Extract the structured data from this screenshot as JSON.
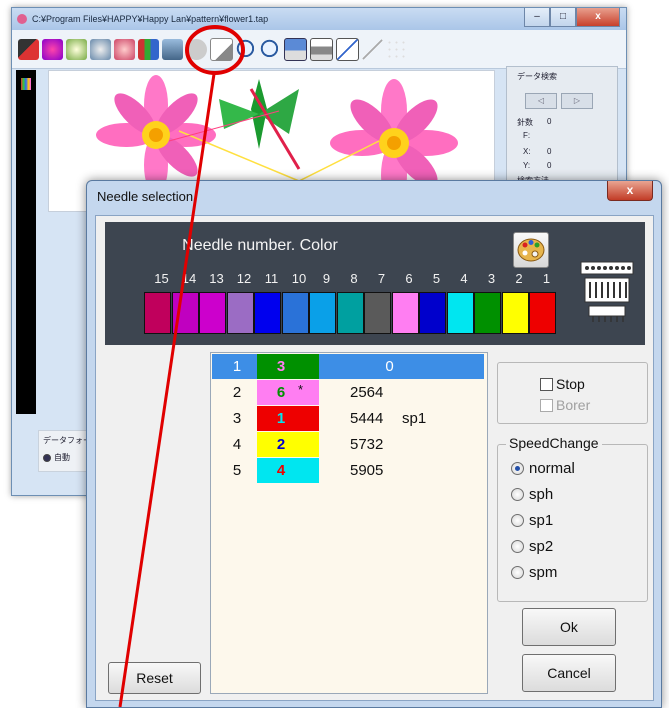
{
  "background_window": {
    "title": "C:¥Program Files¥HAPPY¥Happy Lan¥pattern¥flower1.tap",
    "controls": {
      "minimize": "–",
      "maximize": "□",
      "close": "x"
    },
    "right_panel": {
      "heading": "データ検索",
      "prev": "◁",
      "next": "▷",
      "count_label": "針数",
      "count_value": "0",
      "f_label": "F:",
      "x_label": "X:",
      "x_value": "0",
      "y_label": "Y:",
      "y_value": "0",
      "method_label": "検索方法"
    },
    "lower_left": {
      "label": "データフォーマ",
      "option": "自動"
    }
  },
  "dialog": {
    "title": "Needle selection",
    "close": "x",
    "panel_title": "Needle number.  Color",
    "needles": [
      {
        "num": "15",
        "color": "#c0005c"
      },
      {
        "num": "14",
        "color": "#c000c0"
      },
      {
        "num": "13",
        "color": "#cc00cc"
      },
      {
        "num": "12",
        "color": "#9b6cc4"
      },
      {
        "num": "11",
        "color": "#0000ee"
      },
      {
        "num": "10",
        "color": "#2a72d8"
      },
      {
        "num": "9",
        "color": "#0aa0e8"
      },
      {
        "num": "8",
        "color": "#00a0a0"
      },
      {
        "num": "7",
        "color": "#5a5a5a"
      },
      {
        "num": "6",
        "color": "#ff7ef2"
      },
      {
        "num": "5",
        "color": "#0000cc"
      },
      {
        "num": "4",
        "color": "#00e6f0"
      },
      {
        "num": "3",
        "color": "#009000"
      },
      {
        "num": "2",
        "color": "#ffff00"
      },
      {
        "num": "1",
        "color": "#ee0000"
      }
    ],
    "rows": [
      {
        "index": "1",
        "needle": "3",
        "needle_color": "#009000",
        "text_color": "#ff7ef2",
        "mark": "",
        "count": "0",
        "speed": ""
      },
      {
        "index": "2",
        "needle": "6",
        "needle_color": "#ff7ef2",
        "text_color": "#009000",
        "mark": "*",
        "count": "2564",
        "speed": ""
      },
      {
        "index": "3",
        "needle": "1",
        "needle_color": "#ee0000",
        "text_color": "#00e6f0",
        "mark": "",
        "count": "5444",
        "speed": "sp1"
      },
      {
        "index": "4",
        "needle": "2",
        "needle_color": "#ffff00",
        "text_color": "#0000cc",
        "mark": "",
        "count": "5732",
        "speed": ""
      },
      {
        "index": "5",
        "needle": "4",
        "needle_color": "#00e6f0",
        "text_color": "#ee0000",
        "mark": "",
        "count": "5905",
        "speed": ""
      }
    ],
    "stop_label": "Stop",
    "borer_label": "Borer",
    "speed_group": "SpeedChange",
    "speed_options": [
      "normal",
      "sph",
      "sp1",
      "sp2",
      "spm"
    ],
    "speed_selected": "normal",
    "ok": "Ok",
    "cancel": "Cancel",
    "reset": "Reset"
  },
  "colors": {
    "selection": "#3d8ee6",
    "annotation": "#e00000",
    "panel_bg": "#3d4550"
  }
}
